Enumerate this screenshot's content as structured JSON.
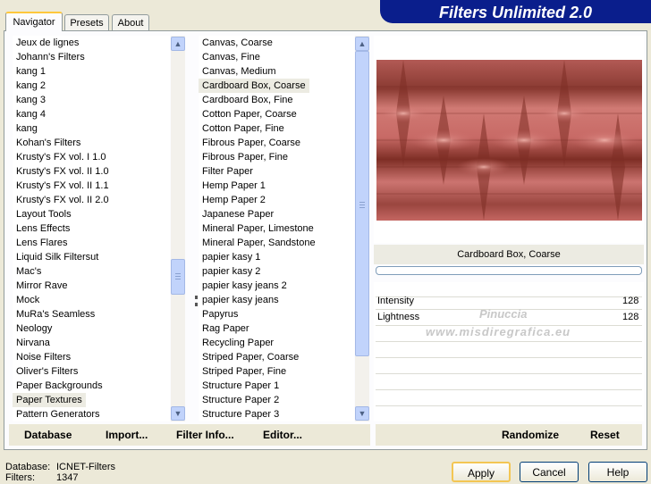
{
  "tabs": [
    {
      "label": "Navigator"
    },
    {
      "label": "Presets"
    },
    {
      "label": "About"
    }
  ],
  "banner": {
    "title": "Filters Unlimited 2.0"
  },
  "categories": {
    "items": [
      "Jeux de lignes",
      "Johann's Filters",
      "kang 1",
      "kang 2",
      "kang 3",
      "kang 4",
      "kang",
      "Kohan's Filters",
      "Krusty's FX vol. I 1.0",
      "Krusty's FX vol. II 1.0",
      "Krusty's FX vol. II 1.1",
      "Krusty's FX vol. II 2.0",
      "Layout Tools",
      "Lens Effects",
      "Lens Flares",
      "Liquid Silk Filtersut",
      "Mac's",
      "Mirror Rave",
      "Mock",
      "MuRa's Seamless",
      "Neology",
      "Nirvana",
      "Noise Filters",
      "Oliver's Filters",
      "Paper Backgrounds",
      "Paper Textures",
      "Pattern Generators"
    ],
    "selected": "Paper Textures"
  },
  "filters": {
    "items": [
      "Canvas, Coarse",
      "Canvas, Fine",
      "Canvas, Medium",
      "Cardboard Box, Coarse",
      "Cardboard Box, Fine",
      "Cotton Paper, Coarse",
      "Cotton Paper, Fine",
      "Fibrous Paper, Coarse",
      "Fibrous Paper, Fine",
      "Filter Paper",
      "Hemp Paper 1",
      "Hemp Paper 2",
      "Japanese Paper",
      "Mineral Paper, Limestone",
      "Mineral Paper, Sandstone",
      "papier kasy 1",
      "papier kasy 2",
      "papier kasy jeans 2",
      "papier kasy jeans",
      "Papyrus",
      "Rag Paper",
      "Recycling Paper",
      "Striped Paper, Coarse",
      "Striped Paper, Fine",
      "Structure Paper 1",
      "Structure Paper 2",
      "Structure Paper 3"
    ],
    "selected": "Cardboard Box, Coarse"
  },
  "preview": {
    "filter_name": "Cardboard Box, Coarse",
    "watermark_name": "Pinuccia",
    "watermark_url": "www.misdiregrafica.eu",
    "colors": {
      "base": "#c86a66",
      "dark": "#7e2e25",
      "light": "#f0b0a8"
    }
  },
  "params": [
    {
      "name": "Intensity",
      "value": "128"
    },
    {
      "name": "Lightness",
      "value": "128"
    }
  ],
  "toolbar": {
    "database": "Database",
    "import": "Import...",
    "filter_info": "Filter Info...",
    "editor": "Editor...",
    "randomize": "Randomize",
    "reset": "Reset"
  },
  "status": {
    "database_label": "Database:",
    "database_value": "ICNET-Filters",
    "filters_label": "Filters:",
    "filters_value": "1347"
  },
  "buttons": {
    "apply": "Apply",
    "cancel": "Cancel",
    "help": "Help"
  }
}
